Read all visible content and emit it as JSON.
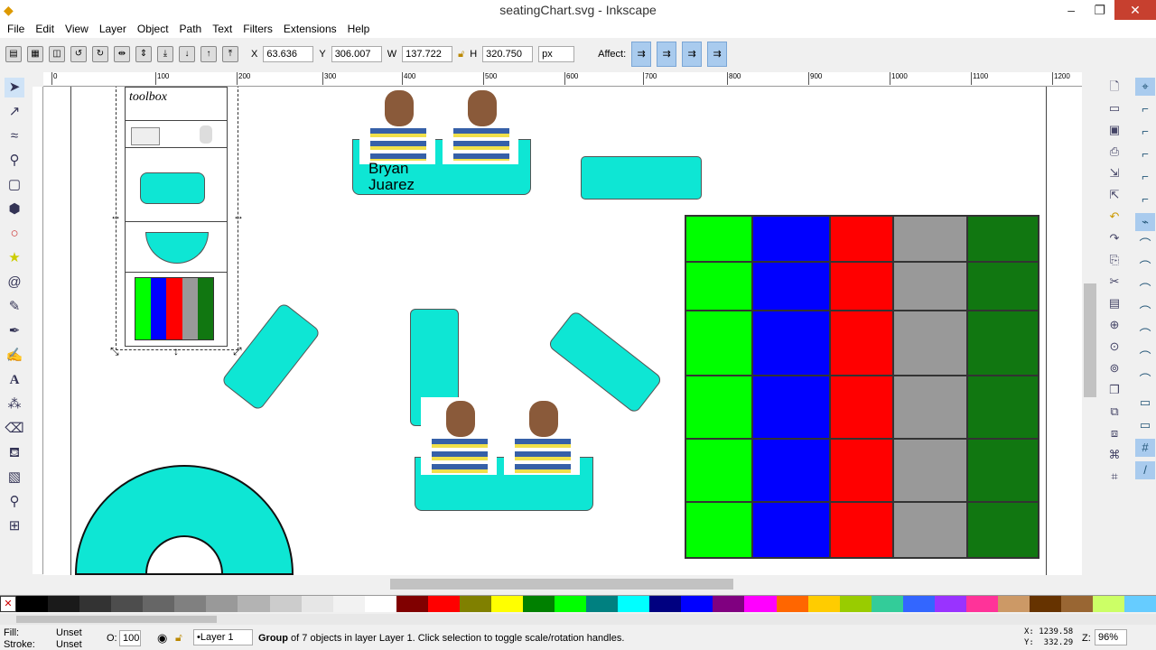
{
  "window": {
    "title": "seatingChart.svg - Inkscape",
    "min": "–",
    "max": "❐",
    "close": "✕"
  },
  "menu": [
    "File",
    "Edit",
    "View",
    "Layer",
    "Object",
    "Path",
    "Text",
    "Filters",
    "Extensions",
    "Help"
  ],
  "toolbar": {
    "x_label": "X",
    "x": "63.636",
    "y_label": "Y",
    "y": "306.007",
    "w_label": "W",
    "w": "137.722",
    "h_label": "H",
    "h": "320.750",
    "unit": "px",
    "affect_label": "Affect:"
  },
  "ruler": [
    "0",
    "100",
    "200",
    "300",
    "400",
    "500",
    "600",
    "700",
    "800",
    "900",
    "1000",
    "1100",
    "1200"
  ],
  "canvas": {
    "toolbox_title": "toolbox",
    "name_label": "Bryan\nJuarez",
    "grid_colors": [
      "#00ff00",
      "#0000ff",
      "#ff0000",
      "#999999",
      "#117711"
    ],
    "accent": "#0ee6d4"
  },
  "palette": [
    "#000000",
    "#1a1a1a",
    "#333333",
    "#4d4d4d",
    "#666666",
    "#808080",
    "#999999",
    "#b3b3b3",
    "#cccccc",
    "#e6e6e6",
    "#f2f2f2",
    "#ffffff",
    "#800000",
    "#ff0000",
    "#808000",
    "#ffff00",
    "#008000",
    "#00ff00",
    "#008080",
    "#00ffff",
    "#000080",
    "#0000ff",
    "#800080",
    "#ff00ff",
    "#ff6600",
    "#ffcc00",
    "#99cc00",
    "#33cc99",
    "#3366ff",
    "#9933ff",
    "#ff3399",
    "#cc9966",
    "#663300",
    "#996633",
    "#ccff66",
    "#66ccff"
  ],
  "status": {
    "fill_label": "Fill:",
    "fill": "Unset",
    "stroke_label": "Stroke:",
    "stroke": "Unset",
    "opacity_label": "O:",
    "opacity": "100",
    "layer": "•Layer 1",
    "message_bold": "Group",
    "message": " of 7 objects in layer Layer 1. Click selection to toggle scale/rotation handles.",
    "cx": "X: 1239.58",
    "cy": "Y:  332.29",
    "zoom_label": "Z:",
    "zoom": "96%"
  }
}
